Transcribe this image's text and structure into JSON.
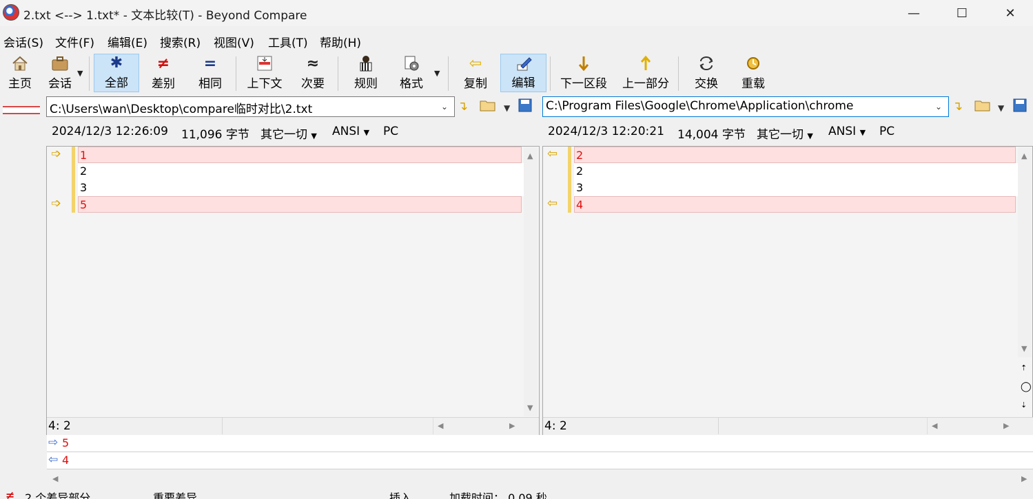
{
  "window": {
    "title": "2.txt <--> 1.txt* - 文本比较(T) - Beyond Compare",
    "minimize": "—",
    "maximize": "☐",
    "close": "✕"
  },
  "menu": [
    "会话(S)",
    "文件(F)",
    "编辑(E)",
    "搜索(R)",
    "视图(V)",
    "工具(T)",
    "帮助(H)"
  ],
  "toolbar": {
    "home": "主页",
    "session": "会话",
    "all": "全部",
    "diffs": "差别",
    "same": "相同",
    "context": "上下文",
    "minor": "次要",
    "rules": "规则",
    "format": "格式",
    "copy": "复制",
    "edit": "编辑",
    "next_section": "下一区段",
    "prev_part": "上一部分",
    "swap": "交换",
    "reload": "重载"
  },
  "left": {
    "path": "C:\\Users\\wan\\Desktop\\compare临时对比\\2.txt",
    "date": "2024/12/3 12:26:09",
    "size": "11,096 字节",
    "other": "其它一切",
    "encoding": "ANSI",
    "lineend": "PC",
    "lines": [
      "1",
      "2",
      "3",
      "5"
    ],
    "cursor": "4: 2"
  },
  "right": {
    "path": "C:\\Program Files\\Google\\Chrome\\Application\\chrome",
    "date": "2024/12/3 12:20:21",
    "size": "14,004 字节",
    "other": "其它一切",
    "encoding": "ANSI",
    "lineend": "PC",
    "lines": [
      "2",
      "2",
      "3",
      "4"
    ],
    "cursor": "4: 2"
  },
  "detail": {
    "left_line": "5",
    "right_line": "4"
  },
  "status": {
    "diff_count": "2 个差异部分",
    "important": "重要差异",
    "mode": "插入",
    "load_time": "加载时间： 0.09 秒"
  },
  "colors": {
    "diff_text": "#e01010",
    "diff_bg": "#ffe0e0",
    "marker": "#f3d36a",
    "active_tool": "#cce4f7"
  }
}
